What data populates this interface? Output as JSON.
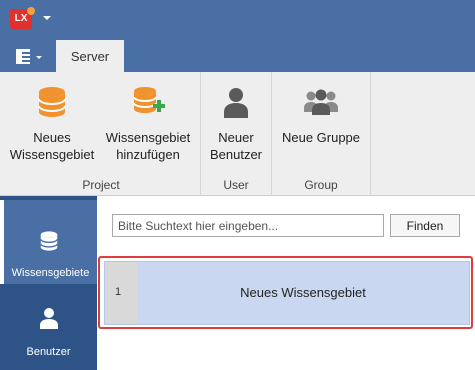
{
  "app": {
    "logo_text": "LX"
  },
  "tabs": [
    {
      "label": "Server"
    }
  ],
  "ribbon": {
    "buttons": {
      "new_kb": {
        "label_line1": "Neues",
        "label_line2": "Wissensgebiet"
      },
      "add_kb": {
        "label_line1": "Wissensgebiet",
        "label_line2": "hinzufügen"
      },
      "new_user": {
        "label_line1": "Neuer",
        "label_line2": "Benutzer"
      },
      "new_group": {
        "label_line1": "Neue Gruppe"
      }
    },
    "groups": {
      "project": "Project",
      "user": "User",
      "group": "Group"
    }
  },
  "nav": {
    "items": [
      {
        "label": "Wissensgebiete",
        "icon": "database-icon",
        "active": true
      },
      {
        "label": "Benutzer",
        "icon": "user-icon",
        "active": false
      }
    ]
  },
  "search": {
    "placeholder": "Bitte Suchtext hier eingeben...",
    "value": "",
    "button_label": "Finden"
  },
  "results": [
    {
      "number": "1",
      "title": "Neues Wissensgebiet"
    }
  ],
  "colors": {
    "titlebar": "#4a6fa5",
    "nav_background": "#2e5386",
    "ribbon_background": "#eeeeee",
    "database_orange": "#f0922e",
    "add_green": "#3aa84a",
    "user_gray": "#5a5a5a",
    "selection": "#c9d8f0",
    "highlight_red": "#e03c3c"
  }
}
